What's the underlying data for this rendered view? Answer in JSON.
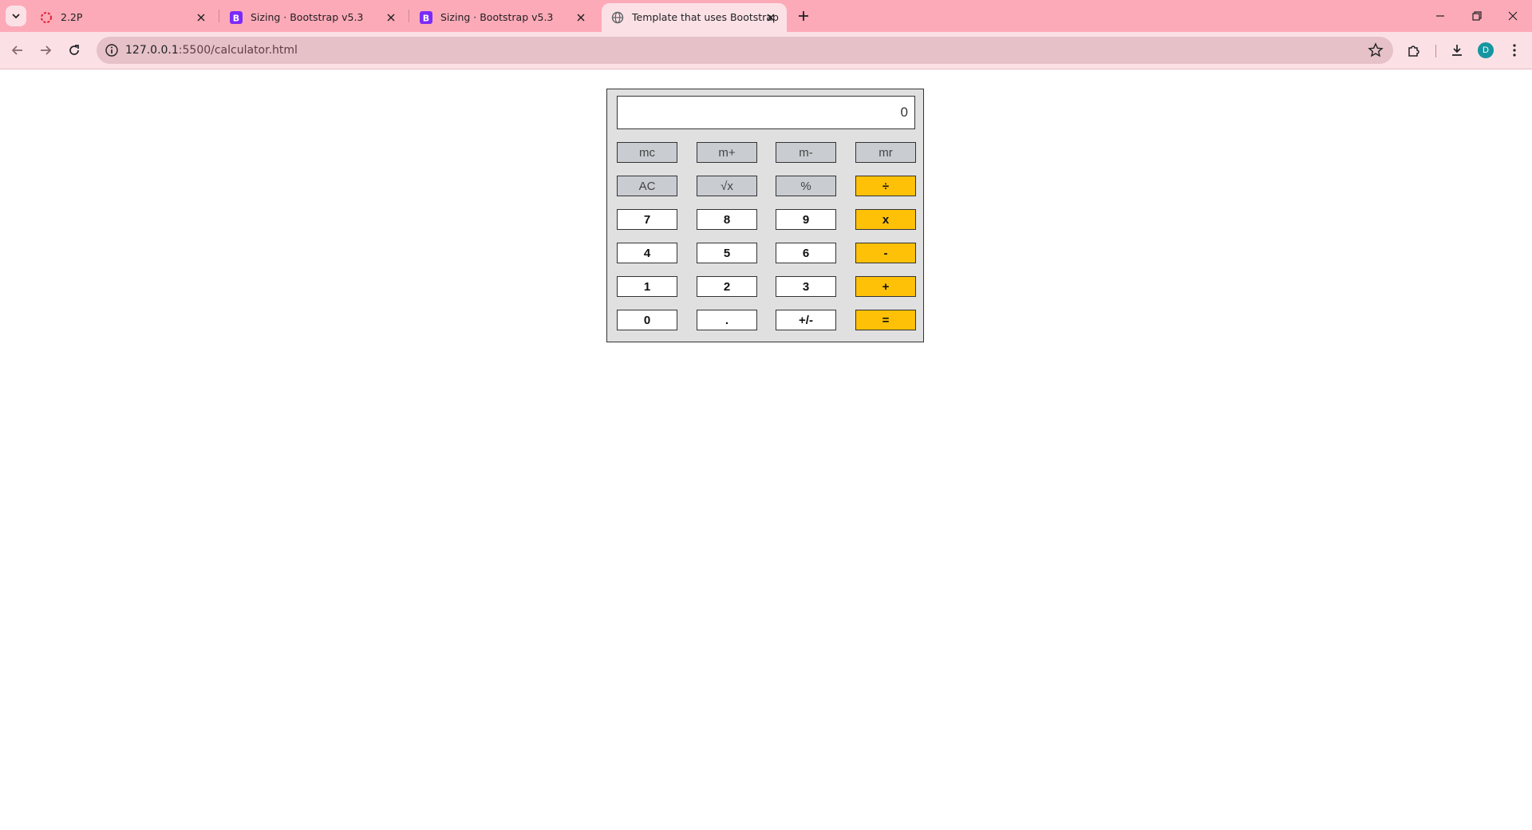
{
  "browser": {
    "tabs": [
      {
        "title": "2.2P",
        "active": false
      },
      {
        "title": "Sizing · Bootstrap v5.3",
        "active": false
      },
      {
        "title": "Sizing · Bootstrap v5.3",
        "active": false
      },
      {
        "title": "Template that uses Bootstrap",
        "active": true
      }
    ],
    "url_host": "127.0.0.1",
    "url_rest": ":5500/calculator.html",
    "profile_initial": "D",
    "colors": {
      "frame": "#fdaab8",
      "toolbar": "#fbe1e6"
    }
  },
  "calculator": {
    "display_value": "0",
    "rows": [
      [
        {
          "label": "mc",
          "kind": "mem"
        },
        {
          "label": "m+",
          "kind": "mem"
        },
        {
          "label": "m-",
          "kind": "mem"
        },
        {
          "label": "mr",
          "kind": "mem"
        }
      ],
      [
        {
          "label": "AC",
          "kind": "mem"
        },
        {
          "label": "√x",
          "kind": "mem"
        },
        {
          "label": "%",
          "kind": "mem"
        },
        {
          "label": "÷",
          "kind": "op"
        }
      ],
      [
        {
          "label": "7",
          "kind": "num"
        },
        {
          "label": "8",
          "kind": "num"
        },
        {
          "label": "9",
          "kind": "num"
        },
        {
          "label": "x",
          "kind": "op"
        }
      ],
      [
        {
          "label": "4",
          "kind": "num"
        },
        {
          "label": "5",
          "kind": "num"
        },
        {
          "label": "6",
          "kind": "num"
        },
        {
          "label": "-",
          "kind": "op"
        }
      ],
      [
        {
          "label": "1",
          "kind": "num"
        },
        {
          "label": "2",
          "kind": "num"
        },
        {
          "label": "3",
          "kind": "num"
        },
        {
          "label": "+",
          "kind": "op"
        }
      ],
      [
        {
          "label": "0",
          "kind": "num"
        },
        {
          "label": ".",
          "kind": "num"
        },
        {
          "label": "+/-",
          "kind": "num"
        },
        {
          "label": "=",
          "kind": "op"
        }
      ]
    ],
    "colors": {
      "body": "#e0e0e0",
      "memory_key": "#c9ccd1",
      "operator_key": "#ffc107",
      "number_key": "#ffffff"
    }
  }
}
